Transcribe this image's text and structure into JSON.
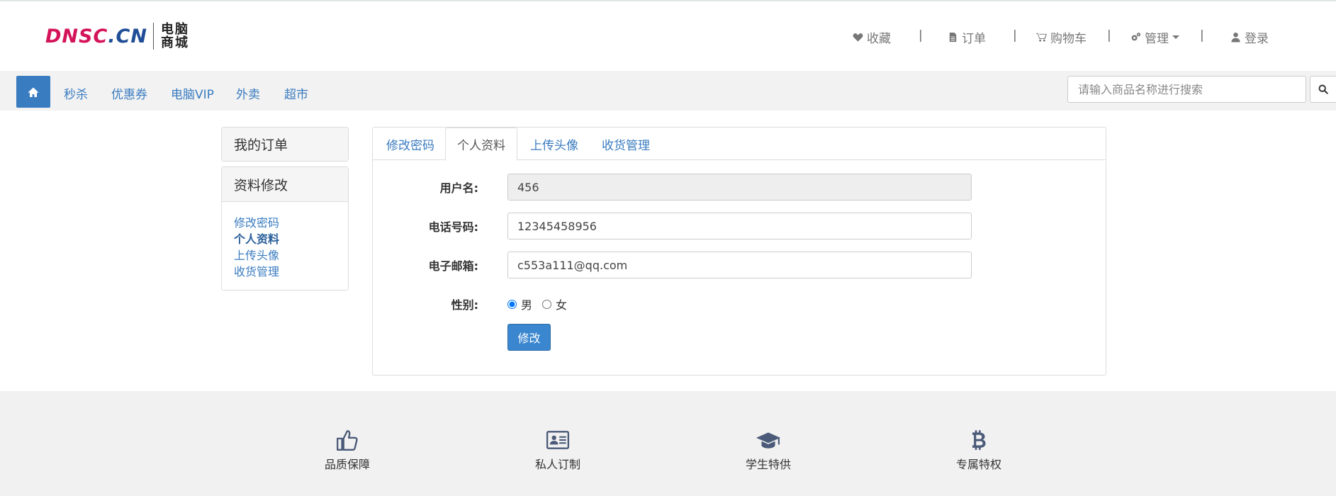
{
  "header": {
    "logo": {
      "text": "DNSC.CN",
      "line1": "电脑",
      "line2": "商城"
    },
    "top_nav": [
      {
        "label": "收藏",
        "icon": "heart-icon"
      },
      {
        "label": "订单",
        "icon": "file-icon"
      },
      {
        "label": "购物车",
        "icon": "cart-icon"
      },
      {
        "label": "管理",
        "icon": "gears-icon"
      },
      {
        "label": "登录",
        "icon": "user-icon"
      }
    ],
    "separator": "|"
  },
  "navbar": {
    "links": [
      "秒杀",
      "优惠券",
      "电脑VIP",
      "外卖",
      "超市"
    ],
    "search_placeholder": "请输入商品名称进行搜索"
  },
  "sidebar": {
    "orders_title": "我的订单",
    "profile_title": "资料修改",
    "links": [
      "修改密码",
      "个人资料",
      "上传头像",
      "收货管理"
    ],
    "active_link": "个人资料"
  },
  "main": {
    "tabs": [
      "修改密码",
      "个人资料",
      "上传头像",
      "收货管理"
    ],
    "active_tab": "个人资料",
    "form": {
      "username_label": "用户名:",
      "username_value": "456",
      "phone_label": "电话号码:",
      "phone_value": "12345458956",
      "email_label": "电子邮箱:",
      "email_value": "c553a111@qq.com",
      "gender_label": "性别:",
      "gender_male": "男",
      "gender_female": "女",
      "gender_selected": "男",
      "submit_label": "修改"
    }
  },
  "footer": {
    "features": [
      {
        "label": "品质保障",
        "icon": "thumbs-up-icon"
      },
      {
        "label": "私人订制",
        "icon": "id-card-icon"
      },
      {
        "label": "学生特供",
        "icon": "graduation-cap-icon"
      },
      {
        "label": "专属特权",
        "icon": "bitcoin-icon"
      }
    ]
  },
  "colors": {
    "accent": "#3a7cc0",
    "logo_pink": "#d4145a",
    "logo_blue": "#1f4e96"
  }
}
